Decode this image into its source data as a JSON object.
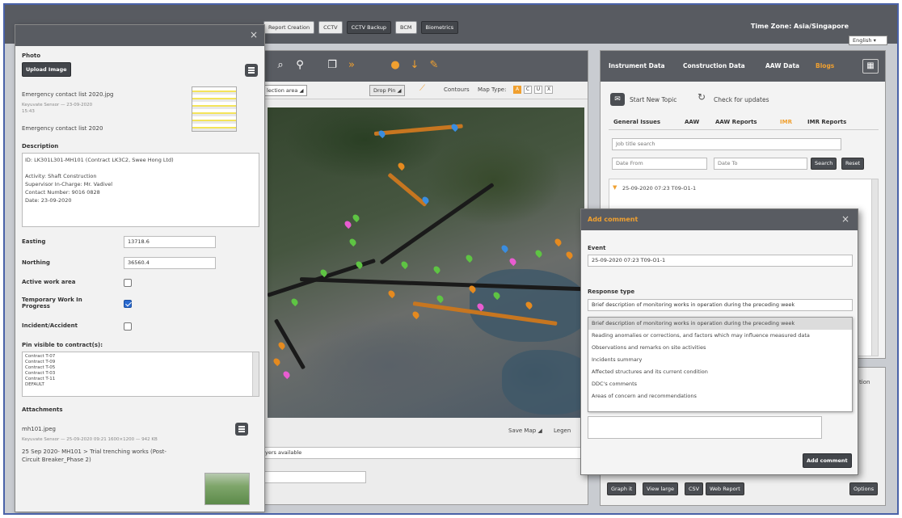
{
  "topbar": {
    "buttons": [
      "Report Creation",
      "CCTV",
      "CCTV Backup",
      "BCM",
      "Biometrics"
    ],
    "timezone": "Time Zone: Asia/Singapore",
    "language": "English"
  },
  "map": {
    "selection_label": "lection area",
    "drop_pin": "Drop Pin",
    "contours": "Contours",
    "map_type_label": "Map Type:",
    "map_types": [
      "A",
      "C",
      "U",
      "X"
    ],
    "save_map": "Save Map",
    "legend": "Legen",
    "layers_text": "yers available"
  },
  "right_panel": {
    "tabs": [
      "Instrument Data",
      "Construction Data",
      "AAW Data",
      "Blogs"
    ],
    "start_new_topic": "Start New Topic",
    "check_updates": "Check for updates",
    "subtabs": [
      "General Issues",
      "AAW",
      "AAW Reports",
      "IMR",
      "IMR Reports"
    ],
    "job_title_search": "Job title search",
    "date_from": "Date From",
    "date_to": "Date To",
    "search": "Search",
    "reset": "Reset",
    "row_text": "25-09-2020 07:23     T09-O1-1",
    "bottom_buttons": [
      "Graph it",
      "View large",
      "CSV",
      "Web Report"
    ],
    "options": "Options",
    "side_text": "tion"
  },
  "left_panel": {
    "photo_label": "Photo",
    "upload_image": "Upload Image",
    "file_name": "Emergency contact list 2020.jpg",
    "file_meta1": "Keyuvate Sensor — 23-09-2020",
    "file_meta2": "15:43",
    "file_caption": "Emergency contact list 2020",
    "description_label": "Description",
    "description_lines": [
      "ID: LK301L301-MH101 (Contract LK3C2, Swee Hong Ltd)",
      "",
      "Activity: Shaft Construction",
      "Supervisor In-Charge: Mr. Vadivel",
      "Contact Number: 9016 0828",
      "Date: 23-09-2020"
    ],
    "easting_label": "Easting",
    "easting_value": "13718.6",
    "northing_label": "Northing",
    "northing_value": "36560.4",
    "active_work_label": "Active work area",
    "temp_work_label_1": "Temporary Work In",
    "temp_work_label_2": "Progress",
    "incident_label": "Incident/Accident",
    "pin_visible_label": "Pin visible to contract(s):",
    "contracts": [
      "Contract T-07",
      "Contract T-09",
      "Contract T-05",
      "Contract T-03",
      "Contract T-11",
      "DEFAULT"
    ],
    "attachments_label": "Attachments",
    "attach_name": "mh101.jpeg",
    "attach_meta": "Keyuvate Sensor — 25-09-2020 09:21   1600×1200 — 942 KB",
    "attach_caption_1": "25 Sep 2020- MH101 > Trial trenching works (Post-",
    "attach_caption_2": "Circuit Breaker_Phase 2)"
  },
  "dialog": {
    "title": "Add comment",
    "event_label": "Event",
    "event_value": "25-09-2020 07:23 T09-O1-1",
    "response_label": "Response type",
    "response_value": "Brief description of monitoring works in operation during the preceding week",
    "options": [
      "Brief description of monitoring works in operation during the preceding week",
      "Reading anomalies or corrections, and factors which may influence measured data",
      "Observations and remarks on site activities",
      "Incidents summary",
      "Affected structures and its current condition",
      "DDC's comments",
      "Areas of concern and recommendations"
    ],
    "add_comment_btn": "Add comment"
  },
  "colors": {
    "accent": "#f0a030",
    "header": "#595c62",
    "checkbox_on": "#2a6ad0"
  }
}
